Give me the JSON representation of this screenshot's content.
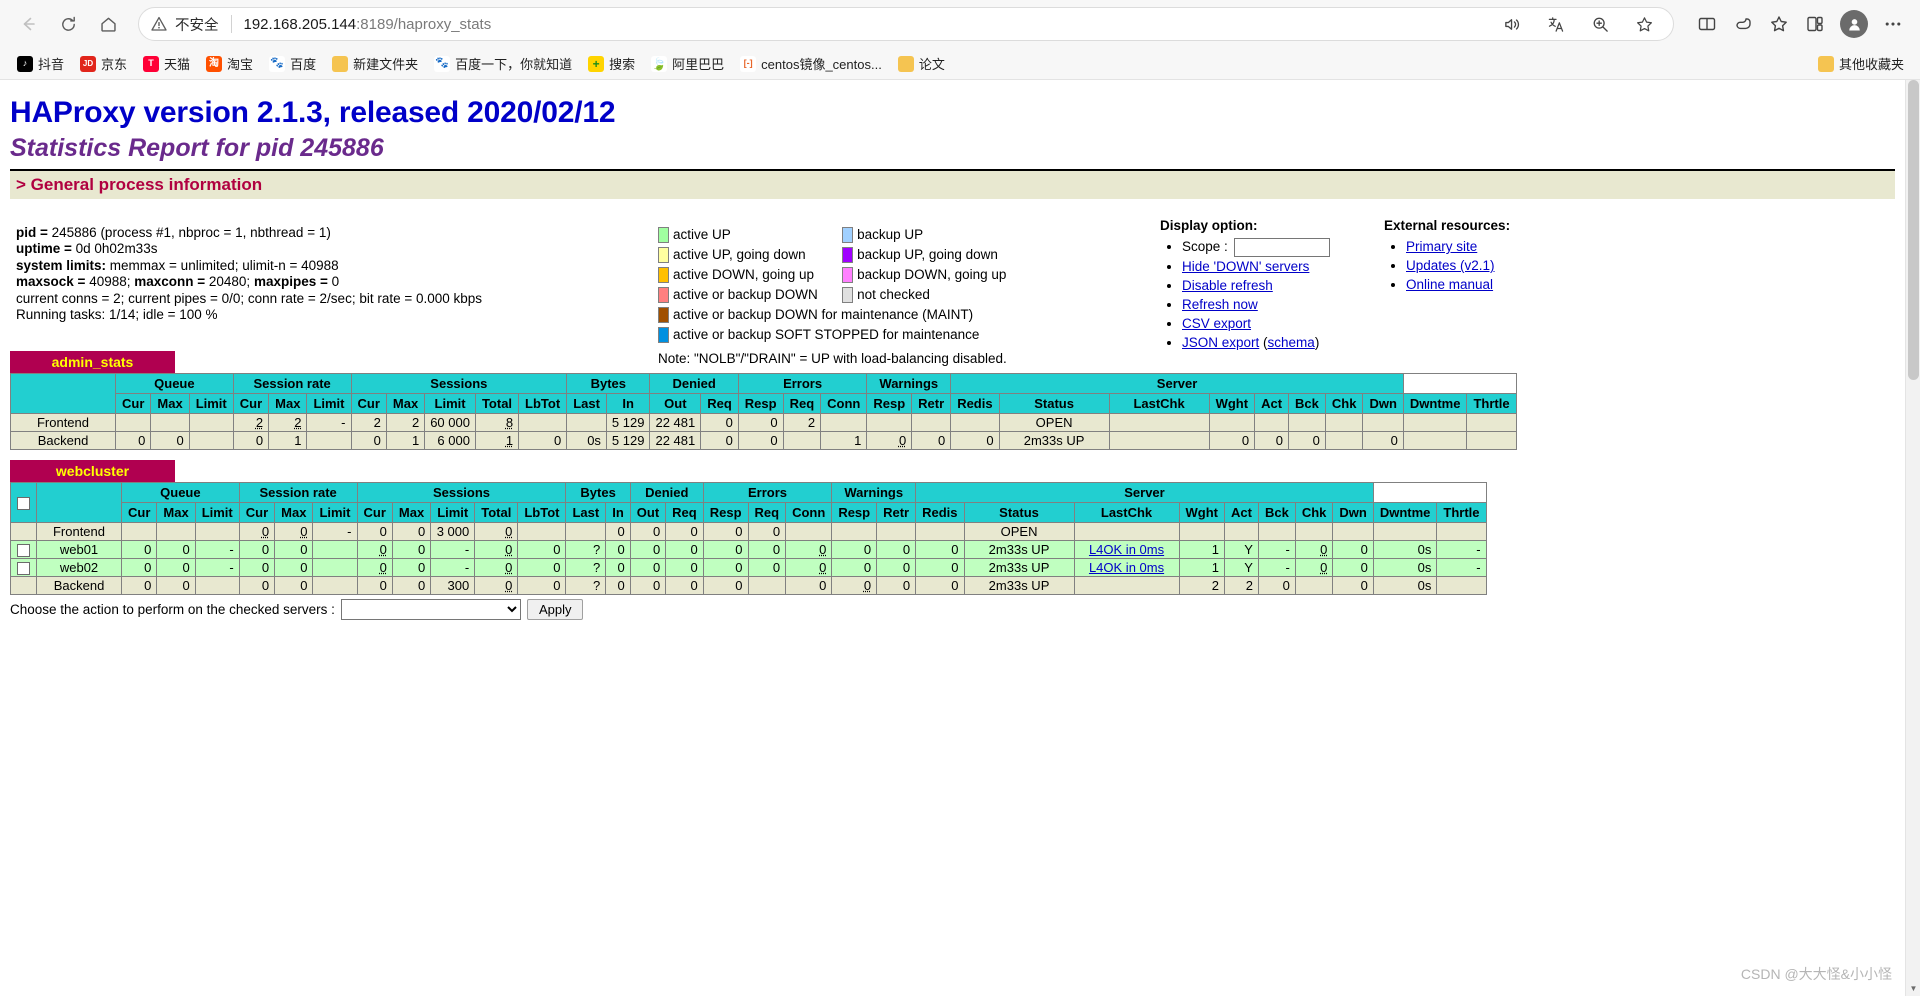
{
  "browser": {
    "back_icon": "back-arrow-icon",
    "refresh_icon": "refresh-icon",
    "home_icon": "home-icon",
    "security_label": "不安全",
    "url_host": "192.168.205.144",
    "url_rest": ":8189/haproxy_stats",
    "read_aloud_icon": "read-aloud-icon",
    "translate_icon": "translate-icon",
    "zoom_icon": "zoom-icon",
    "favorite_icon": "favorite-star-icon",
    "split_icon": "split-screen-icon",
    "copilot_icon": "copilot-icon",
    "collections_icon": "collections-icon",
    "browser_essentials_icon": "browser-essentials-icon",
    "profile_icon": "profile-avatar-icon",
    "settings_icon": "settings-more-icon",
    "bookmarks": [
      {
        "label": "抖音",
        "icon": "douyin-icon",
        "color": "#000000",
        "glyph": "♪"
      },
      {
        "label": "京东",
        "icon": "jd-icon",
        "color": "#e1251b",
        "glyph": "JD"
      },
      {
        "label": "天猫",
        "icon": "tmall-icon",
        "color": "#ff0036",
        "glyph": "T"
      },
      {
        "label": "淘宝",
        "icon": "taobao-icon",
        "color": "#ff5000",
        "glyph": "淘"
      },
      {
        "label": "百度",
        "icon": "baidu-icon",
        "color": "#ffffff",
        "glyph": "🐾"
      },
      {
        "label": "新建文件夹",
        "icon": "folder-icon",
        "color": "#f5c451",
        "glyph": ""
      },
      {
        "label": "百度一下，你就知道",
        "icon": "baidu-icon",
        "color": "#ffffff",
        "glyph": "🐾"
      },
      {
        "label": "搜索",
        "icon": "search-360-icon",
        "color": "#ffd700",
        "glyph": "+"
      },
      {
        "label": "阿里巴巴",
        "icon": "alibaba-icon",
        "color": "#ffffff",
        "glyph": "🍃"
      },
      {
        "label": "centos镜像_centos...",
        "icon": "centos-icon",
        "color": "#ffffff",
        "glyph": "[-]"
      },
      {
        "label": "论文",
        "icon": "folder-icon",
        "color": "#f5c451",
        "glyph": ""
      }
    ],
    "other_favorites": {
      "label": "其他收藏夹",
      "icon": "folder-icon"
    }
  },
  "header": {
    "title": "HAProxy version 2.1.3, released 2020/02/12",
    "subtitle": "Statistics Report for pid 245886",
    "section_title": "> General process information"
  },
  "process_info": {
    "pid_label": "pid = ",
    "pid_value": "245886 (process #1, nbproc = 1, nbthread = 1)",
    "uptime_label": "uptime = ",
    "uptime_value": "0d 0h02m33s",
    "syslimits_label": "system limits:",
    "syslimits_value": " memmax = unlimited; ulimit-n = 40988",
    "maxsock_label": "maxsock = ",
    "maxsock_value": "40988; ",
    "maxconn_label": "maxconn = ",
    "maxconn_value": "20480; ",
    "maxpipes_label": "maxpipes = ",
    "maxpipes_value": "0",
    "conns_line": "current conns = 2; current pipes = 0/0; conn rate = 2/sec; bit rate = 0.000 kbps",
    "tasks_line": "Running tasks: 1/14; idle = 100 %"
  },
  "legend": {
    "left": [
      {
        "label": "active UP",
        "color": "#a0ffa0"
      },
      {
        "label": "active UP, going down",
        "color": "#ffffa0"
      },
      {
        "label": "active DOWN, going up",
        "color": "#ffc000"
      },
      {
        "label": "active or backup DOWN",
        "color": "#ff8080"
      },
      {
        "label": "active or backup DOWN for maintenance (MAINT)",
        "color": "#a05000"
      },
      {
        "label": "active or backup SOFT STOPPED for maintenance",
        "color": "#0090e0"
      }
    ],
    "right": [
      {
        "label": "backup UP",
        "color": "#a0d0ff"
      },
      {
        "label": "backup UP, going down",
        "color": "#a000ff"
      },
      {
        "label": "backup DOWN, going up",
        "color": "#ff80ff"
      },
      {
        "label": "not checked",
        "color": "#e0e0e0"
      }
    ],
    "note": "Note: \"NOLB\"/\"DRAIN\" = UP with load-balancing disabled."
  },
  "display_option": {
    "title": "Display option:",
    "scope_label": "Scope :",
    "scope_value": "",
    "links": [
      "Hide 'DOWN' servers",
      "Disable refresh",
      "Refresh now",
      "CSV export",
      "JSON export"
    ],
    "json_schema_prefix": " (",
    "json_schema": "schema",
    "json_schema_suffix": ")"
  },
  "external_resources": {
    "title": "External resources:",
    "links": [
      "Primary site",
      "Updates (v2.1)",
      "Online manual"
    ]
  },
  "admin_stats": {
    "name": "admin_stats",
    "group_headers": [
      {
        "label": "",
        "span": 1
      },
      {
        "label": "Queue",
        "span": 3
      },
      {
        "label": "Session rate",
        "span": 3
      },
      {
        "label": "Sessions",
        "span": 5
      },
      {
        "label": "Bytes",
        "span": 2
      },
      {
        "label": "Denied",
        "span": 2
      },
      {
        "label": "Errors",
        "span": 3
      },
      {
        "label": "Warnings",
        "span": 2
      },
      {
        "label": "Server",
        "span": 8
      }
    ],
    "sub_headers": [
      "",
      "Cur",
      "Max",
      "Limit",
      "Cur",
      "Max",
      "Limit",
      "Cur",
      "Max",
      "Limit",
      "Total",
      "LbTot",
      "Last",
      "In",
      "Out",
      "Req",
      "Resp",
      "Req",
      "Conn",
      "Resp",
      "Retr",
      "Redis",
      "Status",
      "LastChk",
      "Wght",
      "Act",
      "Bck",
      "Chk",
      "Dwn",
      "Dwntme",
      "Thrtle"
    ],
    "rows": [
      {
        "style": "beige",
        "name": "Frontend",
        "cells": [
          "",
          "",
          "",
          "2",
          "2",
          "-",
          "2",
          "2",
          "60 000",
          "8",
          "",
          "",
          "5 129",
          "22 481",
          "0",
          "0",
          "2",
          "",
          "",
          "",
          "",
          "OPEN",
          "",
          "",
          "",
          "",
          "",
          "",
          "",
          ""
        ],
        "underlined": [
          3,
          4,
          9
        ]
      },
      {
        "style": "beige",
        "name": "Backend",
        "cells": [
          "0",
          "0",
          "",
          "0",
          "1",
          "",
          "0",
          "1",
          "6 000",
          "1",
          "0",
          "0s",
          "5 129",
          "22 481",
          "0",
          "0",
          "",
          "1",
          "0",
          "0",
          "0",
          "2m33s UP",
          "",
          "0",
          "0",
          "0",
          "",
          "0",
          "",
          ""
        ],
        "underlined": [
          9,
          18
        ]
      }
    ]
  },
  "webcluster": {
    "name": "webcluster",
    "group_headers": [
      {
        "label": "",
        "span": 1
      },
      {
        "label": "",
        "span": 1
      },
      {
        "label": "Queue",
        "span": 3
      },
      {
        "label": "Session rate",
        "span": 3
      },
      {
        "label": "Sessions",
        "span": 5
      },
      {
        "label": "Bytes",
        "span": 2
      },
      {
        "label": "Denied",
        "span": 2
      },
      {
        "label": "Errors",
        "span": 3
      },
      {
        "label": "Warnings",
        "span": 2
      },
      {
        "label": "Server",
        "span": 8
      }
    ],
    "sub_headers": [
      "Cur",
      "Max",
      "Limit",
      "Cur",
      "Max",
      "Limit",
      "Cur",
      "Max",
      "Limit",
      "Total",
      "LbTot",
      "Last",
      "In",
      "Out",
      "Req",
      "Resp",
      "Req",
      "Conn",
      "Resp",
      "Retr",
      "Redis",
      "Status",
      "LastChk",
      "Wght",
      "Act",
      "Bck",
      "Chk",
      "Dwn",
      "Dwntme",
      "Thrtle"
    ],
    "rows": [
      {
        "style": "beige",
        "checkbox": false,
        "name": "Frontend",
        "cells": [
          "",
          "",
          "",
          "0",
          "0",
          "-",
          "0",
          "0",
          "3 000",
          "0",
          "",
          "",
          "0",
          "0",
          "0",
          "0",
          "0",
          "",
          "",
          "",
          "",
          "OPEN",
          "",
          "",
          "",
          "",
          "",
          "",
          "",
          ""
        ],
        "underlined": [
          3,
          4,
          9
        ],
        "lastchk_link": ""
      },
      {
        "style": "green",
        "checkbox": true,
        "name": "web01",
        "cells": [
          "0",
          "0",
          "-",
          "0",
          "0",
          "",
          "0",
          "0",
          "-",
          "0",
          "0",
          "?",
          "0",
          "0",
          "0",
          "0",
          "0",
          "0",
          "0",
          "0",
          "0",
          "2m33s UP",
          "L4OK in 0ms",
          "1",
          "Y",
          "-",
          "0",
          "0",
          "0s",
          "-"
        ],
        "underlined": [
          6,
          9,
          17,
          26
        ],
        "lastchk_link": "L4OK in 0ms"
      },
      {
        "style": "green",
        "checkbox": true,
        "name": "web02",
        "cells": [
          "0",
          "0",
          "-",
          "0",
          "0",
          "",
          "0",
          "0",
          "-",
          "0",
          "0",
          "?",
          "0",
          "0",
          "0",
          "0",
          "0",
          "0",
          "0",
          "0",
          "0",
          "2m33s UP",
          "L4OK in 0ms",
          "1",
          "Y",
          "-",
          "0",
          "0",
          "0s",
          "-"
        ],
        "underlined": [
          6,
          9,
          17,
          26
        ],
        "lastchk_link": "L4OK in 0ms"
      },
      {
        "style": "beige",
        "checkbox": false,
        "name": "Backend",
        "cells": [
          "0",
          "0",
          "",
          "0",
          "0",
          "",
          "0",
          "0",
          "300",
          "0",
          "0",
          "?",
          "0",
          "0",
          "0",
          "0",
          "",
          "0",
          "0",
          "0",
          "0",
          "2m33s UP",
          "",
          "2",
          "2",
          "0",
          "",
          "0",
          "0s",
          ""
        ],
        "underlined": [
          9,
          18
        ],
        "lastchk_link": ""
      }
    ]
  },
  "action_bar": {
    "label": "Choose the action to perform on the checked servers :",
    "select_value": "",
    "apply_label": "Apply"
  },
  "watermark": "CSDN @大大怪&小小怪",
  "colors": {
    "title_blue": "#0000c8",
    "subtitle_purple": "#6a2a8c",
    "section_crimson": "#b00040",
    "section_bg": "#e8e8d0",
    "proxy_title_bg": "#b00050",
    "proxy_title_fg": "#ffff00",
    "table_header_bg": "#22cfd0",
    "row_beige": "#e8e8d0",
    "row_green": "#c0ffc0",
    "link_blue": "#0000c8"
  }
}
